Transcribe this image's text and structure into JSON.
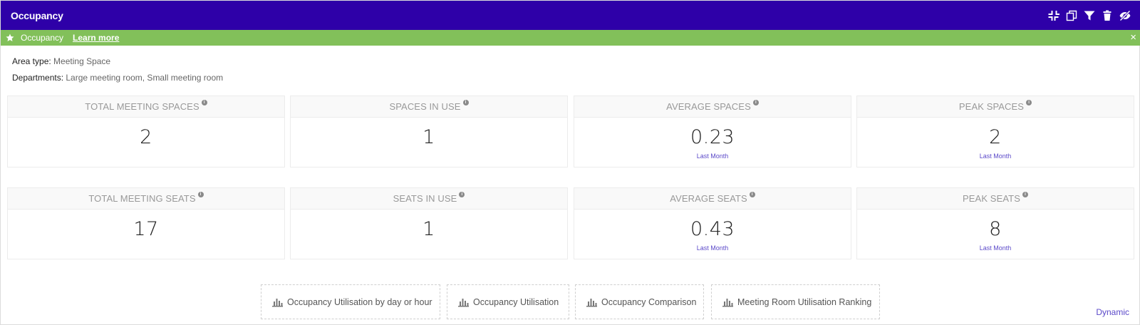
{
  "header": {
    "title": "Occupancy",
    "tools": [
      "collapse-icon",
      "copy-icon",
      "filter-icon",
      "trash-icon",
      "hide-eye-icon"
    ]
  },
  "banner": {
    "label": "Occupancy",
    "link": "Learn more",
    "close": "×"
  },
  "meta": {
    "area_type_label": "Area type:",
    "area_type_value": "Meeting Space",
    "departments_label": "Departments:",
    "departments_value": "Large meeting room, Small meeting room"
  },
  "cards": [
    {
      "title": "TOTAL MEETING SPACES",
      "value": "2",
      "sub": ""
    },
    {
      "title": "SPACES IN USE",
      "value": "1",
      "sub": ""
    },
    {
      "title": "AVERAGE SPACES",
      "value": "0.23",
      "sub": "Last Month"
    },
    {
      "title": "PEAK SPACES",
      "value": "2",
      "sub": "Last Month"
    },
    {
      "title": "TOTAL MEETING SEATS",
      "value": "17",
      "sub": ""
    },
    {
      "title": "SEATS IN USE",
      "value": "1",
      "sub": ""
    },
    {
      "title": "AVERAGE SEATS",
      "value": "0.43",
      "sub": "Last Month"
    },
    {
      "title": "PEAK SEATS",
      "value": "8",
      "sub": "Last Month"
    }
  ],
  "info_glyph": "i",
  "reports": [
    {
      "label": "Occupancy Utilisation by day or hour"
    },
    {
      "label": "Occupancy Utilisation"
    },
    {
      "label": "Occupancy Comparison"
    },
    {
      "label": "Meeting Room Utilisation Ranking"
    }
  ],
  "footer": {
    "mode": "Dynamic"
  },
  "colors": {
    "header_bg": "#2e00a8",
    "banner_bg": "#82c05a",
    "accent": "#5b49c9"
  }
}
